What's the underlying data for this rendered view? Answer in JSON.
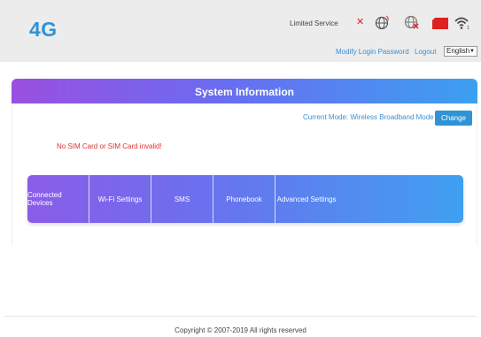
{
  "header": {
    "logo": "4G",
    "service_status": "Limited Service",
    "modify_password": "Modify Login Password",
    "logout": "Logout",
    "language": "English"
  },
  "system": {
    "title": "System Information",
    "current_mode": "Current Mode: Wireless Broadband Mode",
    "change_button": "Change",
    "sim_error": "No SIM Card or SIM Card invalid!"
  },
  "menu": {
    "items": [
      "Connected Devices",
      "Wi-Fi Settings",
      "SMS",
      "Phonebook",
      "Advanced Settings"
    ]
  },
  "footer": {
    "copyright": "Copyright © 2007-2019 All rights reserved"
  },
  "colors": {
    "accent": "#2f93d6",
    "error": "#e03030"
  }
}
